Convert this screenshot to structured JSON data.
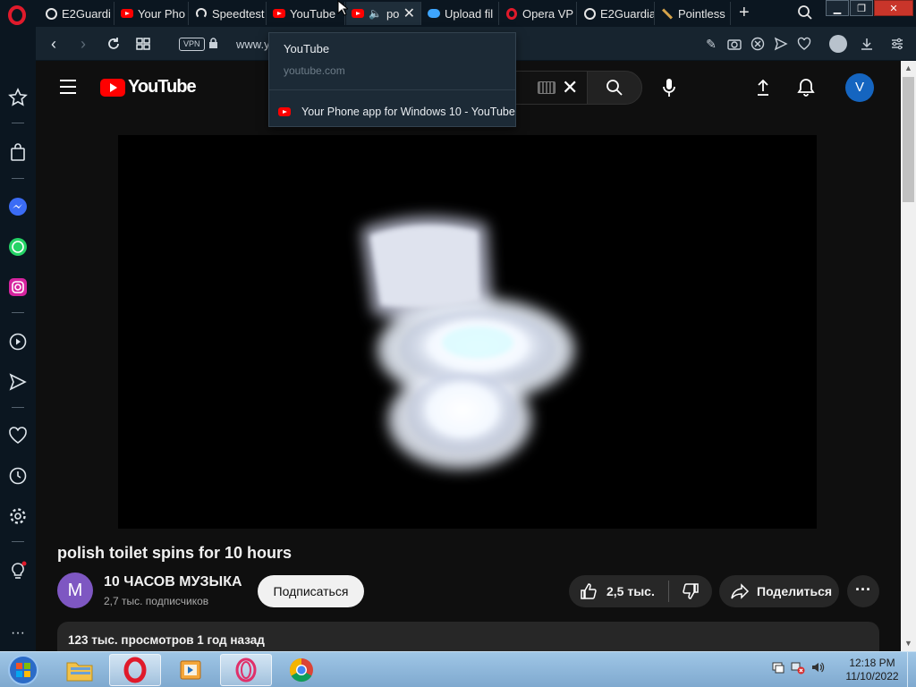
{
  "browser": {
    "tabs": [
      {
        "label": "E2Guardi",
        "icon": "globe-icon"
      },
      {
        "label": "Your Pho",
        "icon": "youtube-icon"
      },
      {
        "label": "Speedtest",
        "icon": "speedtest-icon"
      },
      {
        "label": "YouTube",
        "icon": "youtube-icon",
        "active": true
      },
      {
        "label": "po",
        "icon": "youtube-icon",
        "audio": true,
        "close": "✕"
      },
      {
        "label": "Upload fil",
        "icon": "cloud-icon"
      },
      {
        "label": "Opera VP",
        "icon": "opera-icon"
      },
      {
        "label": "E2Guardia",
        "icon": "globe-icon"
      },
      {
        "label": "Pointless",
        "icon": "pen-icon"
      }
    ],
    "new_tab_label": "+",
    "window_controls": {
      "minimize": "▁",
      "maximize": "❐",
      "close": "✕"
    },
    "addressbar": {
      "vpn_label": "VPN",
      "url_visible": "www.y"
    },
    "tab_preview": {
      "title": "YouTube",
      "url": "youtube.com",
      "item_label": "Your Phone app for Windows 10 - YouTube"
    }
  },
  "sidebar": {
    "items": [
      "star-icon",
      "shopping-bag-icon",
      "messenger-icon",
      "whatsapp-icon",
      "instagram-icon",
      "player-icon",
      "send-icon",
      "heart-icon",
      "history-icon",
      "settings-icon",
      "lightbulb-icon"
    ],
    "more_label": "···"
  },
  "youtube": {
    "logo_text": "YouTube",
    "search_clear": "✕",
    "avatar_letter": "V",
    "video": {
      "title": "polish toilet spins for 10 hours",
      "channel_initial": "M",
      "channel_name": "10 ЧАСОВ МУЗЫКА",
      "subscribers": "2,7 тыс. подписчиков",
      "subscribe_label": "Подписаться",
      "likes": "2,5 тыс.",
      "share_label": "Поделиться",
      "more_label": "···",
      "description_meta": "123 тыс. просмотров  1 год назад"
    }
  },
  "taskbar": {
    "clock_time": "12:18 PM",
    "clock_date": "11/10/2022"
  },
  "colors": {
    "youtube_red": "#ff0000",
    "opera_red": "#e01a2b",
    "browser_chrome": "#0b1620",
    "page_bg": "#0f0f0f"
  }
}
